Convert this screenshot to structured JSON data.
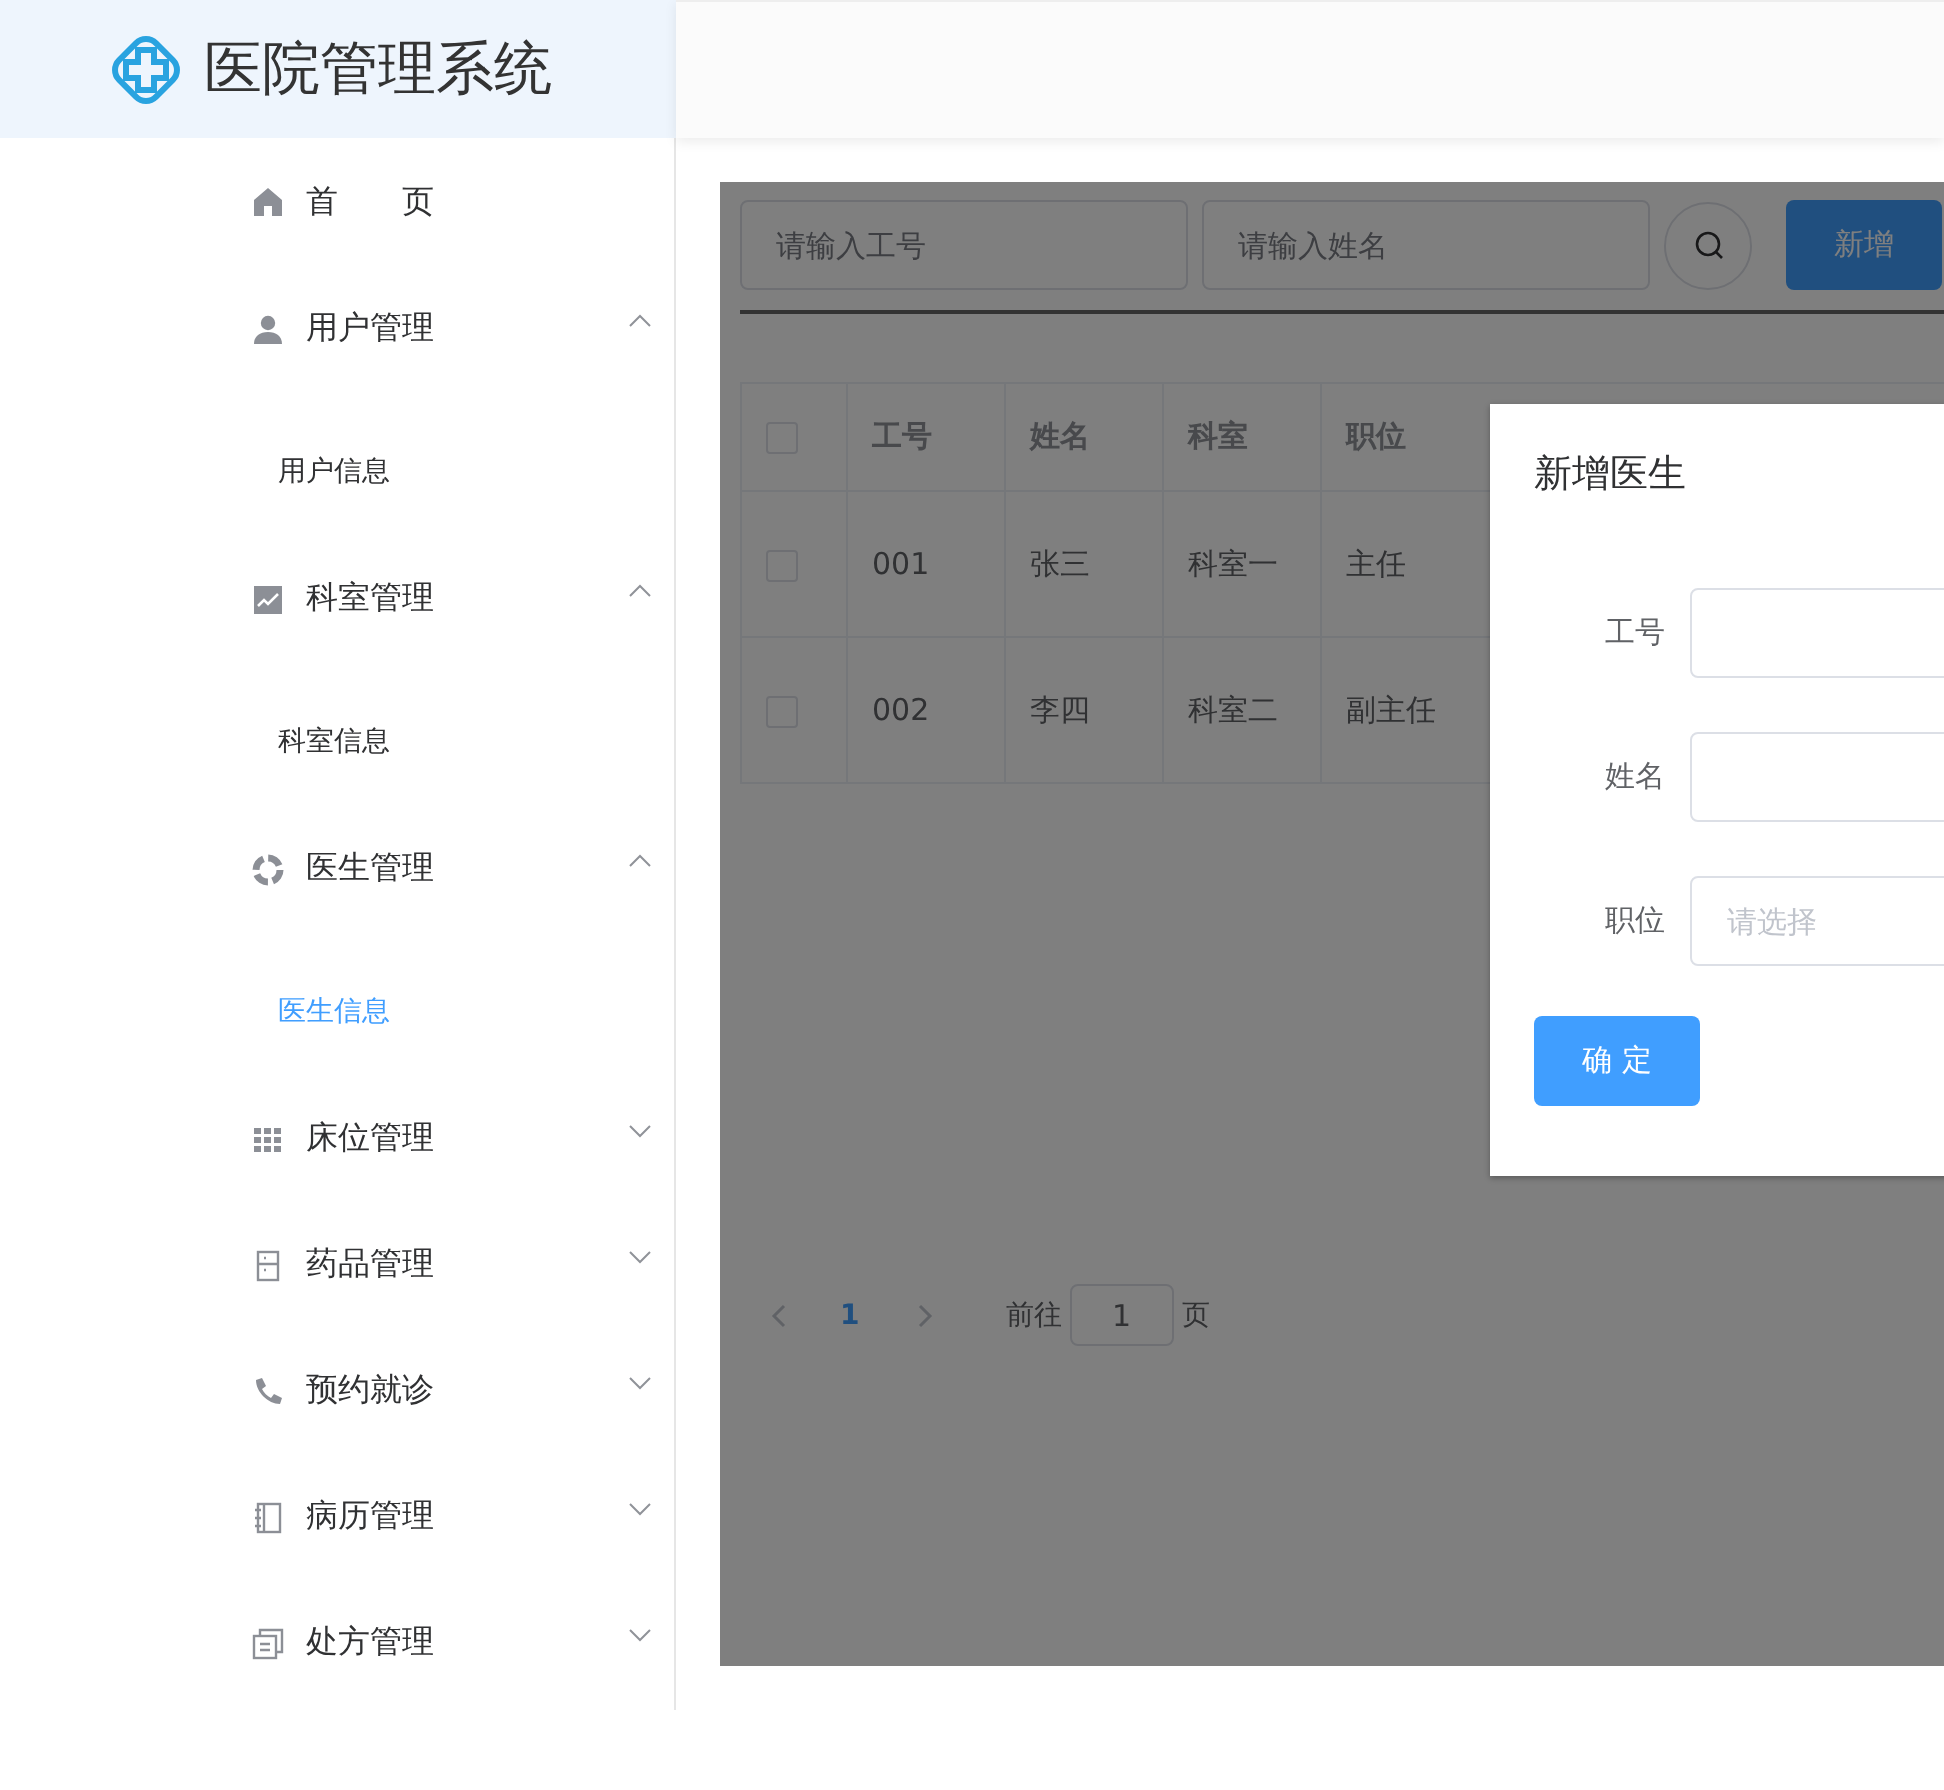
{
  "app": {
    "title": "医院管理系统"
  },
  "sidebar": {
    "items": [
      {
        "label": "首　　页",
        "selected": false
      },
      {
        "label": "用户管理",
        "expanded": true,
        "children": [
          {
            "label": "用户信息",
            "selected": false
          }
        ]
      },
      {
        "label": "科室管理",
        "expanded": true,
        "children": [
          {
            "label": "科室信息",
            "selected": false
          }
        ]
      },
      {
        "label": "医生管理",
        "expanded": true,
        "children": [
          {
            "label": "医生信息",
            "selected": true
          }
        ]
      },
      {
        "label": "床位管理",
        "expanded": false
      },
      {
        "label": "药品管理",
        "expanded": false
      },
      {
        "label": "预约就诊",
        "expanded": false
      },
      {
        "label": "病历管理",
        "expanded": false
      },
      {
        "label": "处方管理",
        "expanded": false
      }
    ]
  },
  "toolbar": {
    "search_fields": [
      {
        "placeholder": "请输入工号"
      },
      {
        "placeholder": "请输入姓名"
      }
    ],
    "add_button": "新增"
  },
  "table": {
    "columns": [
      "工号",
      "姓名",
      "科室",
      "职位"
    ],
    "header_checked": false,
    "rows": [
      {
        "checked": false,
        "cells": [
          "001",
          "张三",
          "科室一",
          "主任"
        ]
      },
      {
        "checked": false,
        "cells": [
          "002",
          "李四",
          "科室二",
          "副主任"
        ]
      }
    ]
  },
  "pagination": {
    "pages": [
      {
        "label": "1",
        "selected": true
      }
    ],
    "goto_label": "前往",
    "goto_value": "1",
    "goto_suffix": "页"
  },
  "dialog": {
    "title": "新增医生",
    "fields": [
      {
        "label": "工号"
      },
      {
        "label": "姓名"
      },
      {
        "label": "职位",
        "placeholder": "请选择"
      }
    ],
    "confirm_button": "确 定"
  }
}
